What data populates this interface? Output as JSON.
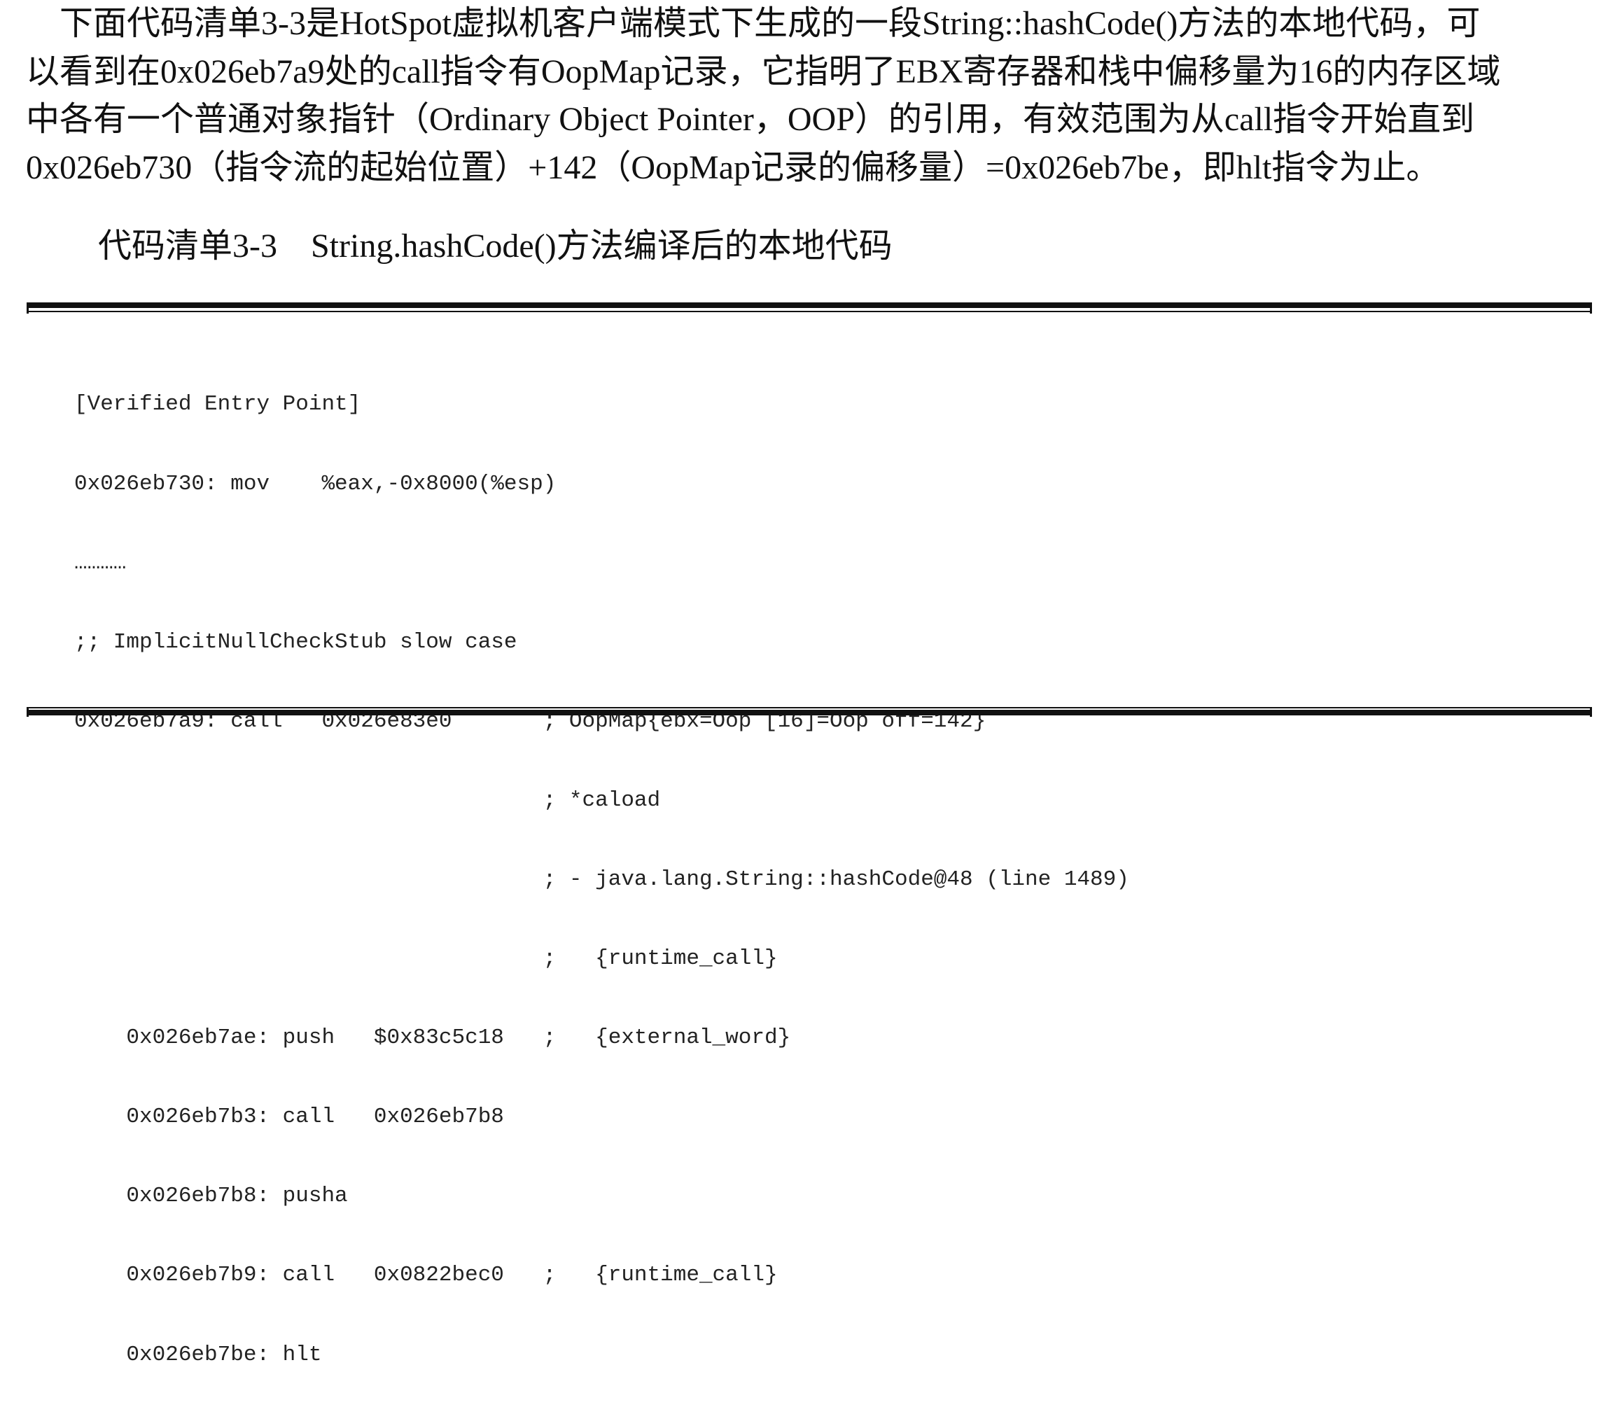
{
  "paragraph": {
    "lines": [
      "    下面代码清单3-3是HotSpot虚拟机客户端模式下生成的一段String::hashCode()方法的本地代码，可",
      "以看到在0x026eb7a9处的call指令有OopMap记录，它指明了EBX寄存器和栈中偏移量为16的内存区域",
      "中各有一个普通对象指针（Ordinary Object Pointer，OOP）的引用，有效范围为从call指令开始直到",
      "0x026eb730（指令流的起始位置）+142（OopMap记录的偏移量）=0x026eb7be，即hlt指令为止。"
    ]
  },
  "listing": {
    "title": "代码清单3-3    String.hashCode()方法编译后的本地代码",
    "code_lines": [
      "[Verified Entry Point]",
      "0x026eb730: mov    %eax,-0x8000(%esp)",
      "…………",
      ";; ImplicitNullCheckStub slow case",
      "0x026eb7a9: call   0x026e83e0       ; OopMap{ebx=Oop [16]=Oop off=142}",
      "                                    ; *caload",
      "                                    ; - java.lang.String::hashCode@48 (line 1489)",
      "                                    ;   {runtime_call}",
      "    0x026eb7ae: push   $0x83c5c18   ;   {external_word}",
      "    0x026eb7b3: call   0x026eb7b8",
      "    0x026eb7b8: pusha",
      "    0x026eb7b9: call   0x0822bec0   ;   {runtime_call}",
      "    0x026eb7be: hlt"
    ]
  }
}
